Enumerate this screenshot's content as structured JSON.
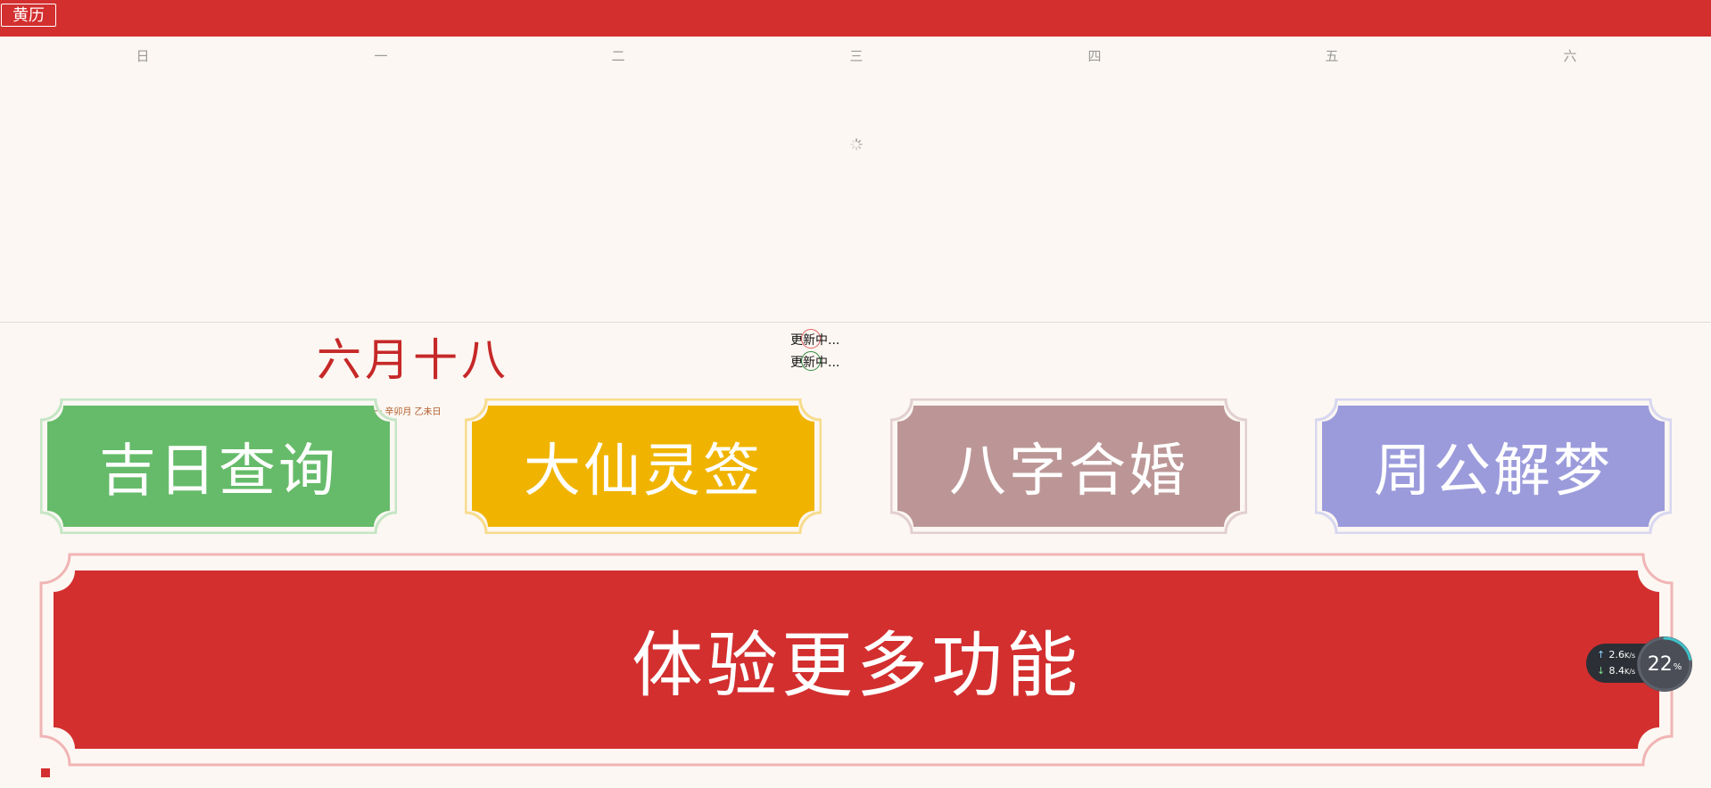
{
  "header": {
    "title_button": "黄历",
    "bar_color": "#d32f2f"
  },
  "calendar": {
    "weekdays": [
      "日",
      "一",
      "二",
      "三",
      "四",
      "五",
      "六"
    ]
  },
  "date": {
    "lunar": "六月十八",
    "detail": "年 星期一 辛卯月 乙未日"
  },
  "status": {
    "line1": "更新中...",
    "line2": "更新中..."
  },
  "tiles": [
    {
      "label": "吉日查询",
      "color": "#66bb6a",
      "border": "#c6e6c6"
    },
    {
      "label": "大仙灵签",
      "color": "#f0b400",
      "border": "#f7dc8d"
    },
    {
      "label": "八字合婚",
      "color": "#bc9696",
      "border": "#e2cfcf"
    },
    {
      "label": "周公解梦",
      "color": "#9b9bdc",
      "border": "#d7d7f0"
    }
  ],
  "banner": {
    "label": "体验更多功能",
    "color": "#d32f2f",
    "border": "#f0b4b4"
  },
  "network": {
    "upload": "2.6",
    "upload_unit": "K/s",
    "download": "8.4",
    "download_unit": "K/s",
    "percent": "22",
    "percent_unit": "%"
  }
}
